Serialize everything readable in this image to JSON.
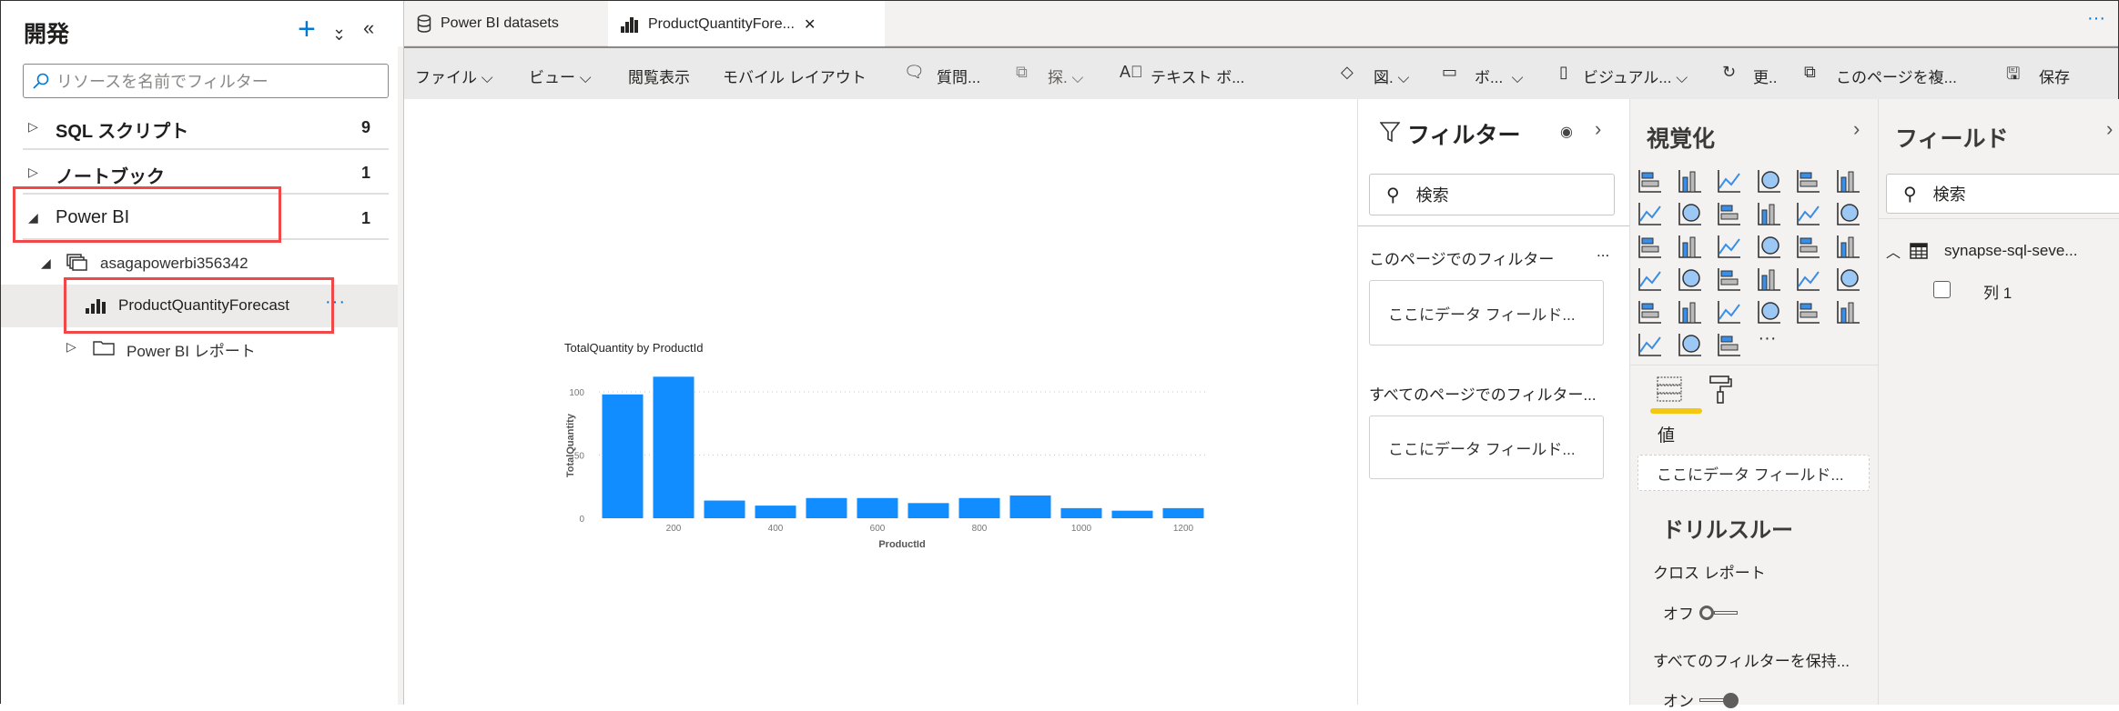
{
  "sidebar": {
    "title": "開発",
    "search_placeholder": "リソースを名前でフィルター",
    "sections": [
      {
        "label": "SQL スクリプト",
        "count": "9"
      },
      {
        "label": "ノートブック",
        "count": "1"
      },
      {
        "label": "Power BI",
        "count": "1"
      }
    ],
    "workspace": "asagapowerbi356342",
    "selected_report": "ProductQuantityForecast",
    "more": "···",
    "reports_folder": "Power BI レポート"
  },
  "tabs": [
    {
      "label": "Power BI datasets"
    },
    {
      "label": "ProductQuantityFore...",
      "close": "✕"
    }
  ],
  "tabs_more": "···",
  "toolbar": {
    "file": "ファイル",
    "view": "ビュー",
    "reading": "閲覧表示",
    "mobile": "モバイル レイアウト",
    "qa": "質問...",
    "explore": "探.",
    "textbox": "テキスト ボ...",
    "shapes": "図.",
    "buttons": "ボ...",
    "visual": "ビジュアル...",
    "refresh": "更..",
    "duplicate": "このページを複...",
    "save": "保存"
  },
  "filters": {
    "title": "フィルター",
    "search": "検索",
    "page_filters": "このページでのフィルター",
    "page_more": "...",
    "drop1": "ここにデータ フィールド...",
    "all_filters": "すべてのページでのフィルター...",
    "drop2": "ここにデータ フィールド..."
  },
  "viz": {
    "title": "視覚化",
    "icons": [
      "stacked-bar",
      "stacked-column",
      "clustered-bar",
      "clustered-column",
      "100-bar",
      "100-column",
      "line",
      "area",
      "stacked-area",
      "line-column",
      "line-clustered-column",
      "ribbon",
      "waterfall",
      "funnel",
      "scatter",
      "pie",
      "donut",
      "treemap",
      "map",
      "filled-map",
      "gauge",
      "card",
      "multi-row-card",
      "kpi",
      "slicer",
      "table",
      "matrix",
      "key-influencers",
      "decomposition-tree",
      "qa",
      "paginated",
      "arcgis",
      "power-apps"
    ],
    "more": "···",
    "values_label": "値",
    "drop": "ここにデータ フィールド...",
    "drillthrough": "ドリルスルー",
    "cross_report": "クロス レポート",
    "cross_report_state": "オフ",
    "keep_filters": "すべてのフィルターを保持...",
    "keep_filters_state": "オン",
    "accent": "#f2c811"
  },
  "fields": {
    "title": "フィールド",
    "search": "検索",
    "table": "synapse-sql-seve...",
    "column": "列 1"
  },
  "chart_data": {
    "type": "bar",
    "title": "TotalQuantity by ProductId",
    "xlabel": "ProductId",
    "ylabel": "TotalQuantity",
    "categories": [
      100,
      200,
      300,
      400,
      500,
      600,
      700,
      800,
      900,
      1000,
      1100,
      1200
    ],
    "values": [
      98,
      112,
      14,
      10,
      16,
      16,
      12,
      16,
      18,
      8,
      6,
      8
    ],
    "xticks": [
      "200",
      "400",
      "600",
      "800",
      "1000",
      "1200"
    ],
    "yticks": [
      "0",
      "50",
      "100"
    ],
    "ylim": [
      0,
      115
    ],
    "grid": true,
    "color": "#118dff"
  }
}
